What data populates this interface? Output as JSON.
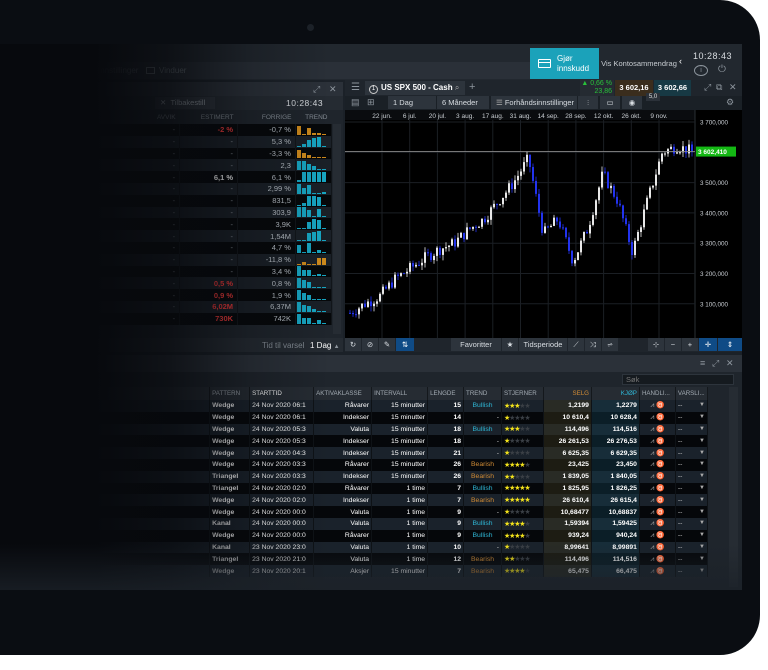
{
  "topbar": {
    "tabs": [
      "Innstillinger",
      "Vinduer"
    ],
    "deposit_label": "Gjør innskudd",
    "summary_label": "Vis Kontosammendrag",
    "clock": "10:28:43"
  },
  "left_panel": {
    "reset_label": "Tilbakestill",
    "clock": "10:28:43",
    "columns": [
      "AVVIK",
      "ESTIMERT",
      "FORRIGE",
      "TREND"
    ],
    "rows": [
      {
        "avvik": "-",
        "est": "-2 %",
        "est_style": "red",
        "prev": "-0,7 %",
        "trend": [
          8,
          0,
          6,
          2,
          2,
          1
        ],
        "tc": "#d08b1c"
      },
      {
        "avvik": "-",
        "est": "-",
        "prev": "5,3 %",
        "trend": [
          1,
          2,
          6,
          8,
          9,
          0
        ],
        "tc": "#17a7c4"
      },
      {
        "avvik": "-",
        "est": "-",
        "prev": "-3,3 %",
        "trend": [
          8,
          5,
          3,
          1,
          1,
          0
        ],
        "tc": "#d08b1c"
      },
      {
        "avvik": "-",
        "est": "-",
        "prev": "2,3",
        "trend": [
          8,
          8,
          6,
          4,
          1,
          0
        ],
        "tc": "#17a7c4"
      },
      {
        "avvik": "-",
        "est": "6,1 %",
        "est_style": "wh",
        "prev": "6,1 %",
        "trend": [
          2,
          9,
          9,
          9,
          9,
          9
        ],
        "tc": "#17a7c4"
      },
      {
        "avvik": "-",
        "est": "-",
        "prev": "2,99 %",
        "trend": [
          9,
          5,
          8,
          0,
          1,
          2
        ],
        "tc": "#17a7c4"
      },
      {
        "avvik": "-",
        "est": "-",
        "prev": "831,5",
        "trend": [
          1,
          2,
          9,
          9,
          8,
          0
        ],
        "tc": "#17a7c4"
      },
      {
        "avvik": "-",
        "est": "-",
        "prev": "303,9",
        "trend": [
          9,
          9,
          7,
          1,
          8,
          0
        ],
        "tc": "#17a7c4"
      },
      {
        "avvik": "-",
        "est": "-",
        "prev": "3,9K",
        "trend": [
          0,
          1,
          7,
          9,
          8,
          0
        ],
        "tc": "#17a7c4"
      },
      {
        "avvik": "-",
        "est": "-",
        "prev": "1,54M",
        "trend": [
          0,
          1,
          7,
          8,
          9,
          0
        ],
        "tc": "#17a7c4"
      },
      {
        "avvik": "-",
        "est": "-",
        "prev": "4,7 %",
        "trend": [
          7,
          0,
          9,
          0,
          3,
          0
        ],
        "tc": "#17a7c4"
      },
      {
        "avvik": "-",
        "est": "-",
        "prev": "-11,8 %",
        "trend": [
          1,
          2,
          1,
          0,
          6,
          6
        ],
        "tc": "#d08b1c"
      },
      {
        "avvik": "-",
        "est": "-",
        "prev": "3,4 %",
        "trend": [
          9,
          6,
          6,
          1,
          2,
          0
        ],
        "tc": "#17a7c4"
      },
      {
        "avvik": "-",
        "est": "0,5 %",
        "est_style": "red",
        "prev": "0,8 %",
        "trend": [
          9,
          7,
          6,
          1,
          1,
          0
        ],
        "tc": "#17a7c4"
      },
      {
        "avvik": "-",
        "est": "0,9 %",
        "est_style": "red",
        "prev": "1,9 %",
        "trend": [
          9,
          6,
          5,
          1,
          1,
          0
        ],
        "tc": "#17a7c4"
      },
      {
        "avvik": "-",
        "est": "6,02M",
        "est_style": "red",
        "prev": "6,37M",
        "trend": [
          9,
          6,
          5,
          3,
          1,
          0
        ],
        "tc": "#17a7c4"
      },
      {
        "avvik": "-",
        "est": "730K",
        "est_style": "red",
        "prev": "742K",
        "trend": [
          9,
          5,
          5,
          1,
          3,
          0
        ],
        "tc": "#17a7c4"
      }
    ],
    "footer_label": "Tid til varsel",
    "footer_value": "1 Dag"
  },
  "chart": {
    "instrument": "US SPX 500 - Cash",
    "change_pct": "0,66 %",
    "change_abs": "23,86",
    "sell": "3 602,16",
    "buy": "3 602,66",
    "spread": "5,0",
    "interval": "1 Dag",
    "period": "6 Måneder",
    "presets_label": "Forhåndsinnstillinger",
    "date_labels": [
      "22 jun.",
      "6 jul.",
      "20 jul.",
      "3 aug.",
      "17 aug.",
      "31 aug.",
      "14 sep.",
      "28 sep.",
      "12 okt.",
      "26 okt.",
      "9 nov."
    ],
    "price_labels": [
      "3 700,000",
      "3 600,000",
      "3 500,000",
      "3 400,000",
      "3 300,000",
      "3 200,000",
      "3 100,000"
    ],
    "current_price": "3 602,410",
    "current_value": 3602.41,
    "closes": [
      3070,
      3100,
      3125,
      3180,
      3215,
      3250,
      3280,
      3300,
      3345,
      3380,
      3440,
      3500,
      3580,
      3330,
      3380,
      3240,
      3350,
      3530,
      3440,
      3270,
      3440,
      3600,
      3620,
      3602.41
    ],
    "favorites_label": "Favoritter",
    "timeperiod_label": "Tidsperiode",
    "colors": {
      "up": "#e8e8e8",
      "down": "#2233ee",
      "price_tag": "#14b814"
    }
  },
  "scanner": {
    "search_placeholder": "Søk",
    "columns": [
      "PATTERN",
      "STARTTID",
      "AKTIVAKLASSE",
      "INTERVALL",
      "LENGDE",
      "TREND",
      "STJERNER",
      "SELG",
      "KJØP",
      "HANDLI...",
      "VARSLI..."
    ],
    "rows": [
      [
        "Wedge",
        "24 Nov 2020 06:1",
        "Råvarer",
        "15 minutter",
        "15",
        "Bullish",
        3,
        "1,2199",
        "1,2279"
      ],
      [
        "Wedge",
        "24 Nov 2020 06:1",
        "Indekser",
        "15 minutter",
        "14",
        "-",
        1,
        "10 610,4",
        "10 628,4"
      ],
      [
        "Wedge",
        "24 Nov 2020 05:3",
        "Valuta",
        "15 minutter",
        "18",
        "Bullish",
        3,
        "114,496",
        "114,516"
      ],
      [
        "Wedge",
        "24 Nov 2020 05:3",
        "Indekser",
        "15 minutter",
        "18",
        "-",
        1,
        "26 261,53",
        "26 276,53"
      ],
      [
        "Wedge",
        "24 Nov 2020 04:3",
        "Indekser",
        "15 minutter",
        "21",
        "-",
        1,
        "6 625,35",
        "6 629,35"
      ],
      [
        "Wedge",
        "24 Nov 2020 03:3",
        "Råvarer",
        "15 minutter",
        "26",
        "Bearish",
        4,
        "23,425",
        "23,450"
      ],
      [
        "Triangel",
        "24 Nov 2020 03:3",
        "Indekser",
        "15 minutter",
        "26",
        "Bearish",
        2,
        "1 839,05",
        "1 840,05"
      ],
      [
        "Triangel",
        "24 Nov 2020 02:0",
        "Råvarer",
        "1 time",
        "7",
        "Bullish",
        5,
        "1 825,95",
        "1 826,25"
      ],
      [
        "Wedge",
        "24 Nov 2020 02:0",
        "Indekser",
        "1 time",
        "7",
        "Bearish",
        5,
        "26 610,4",
        "26 615,4"
      ],
      [
        "Wedge",
        "24 Nov 2020 00:0",
        "Valuta",
        "1 time",
        "9",
        "-",
        1,
        "10,68477",
        "10,68837"
      ],
      [
        "Kanal",
        "24 Nov 2020 00:0",
        "Valuta",
        "1 time",
        "9",
        "Bullish",
        4,
        "1,59394",
        "1,59425"
      ],
      [
        "Wedge",
        "24 Nov 2020 00:0",
        "Råvarer",
        "1 time",
        "9",
        "Bullish",
        4,
        "939,24",
        "940,24"
      ],
      [
        "Kanal",
        "23 Nov 2020 23:0",
        "Valuta",
        "1 time",
        "10",
        "-",
        1,
        "8,99641",
        "8,99891"
      ],
      [
        "Triangel",
        "23 Nov 2020 21:0",
        "Valuta",
        "1 time",
        "12",
        "Bearish",
        2,
        "114,496",
        "114,516"
      ],
      [
        "Wedge",
        "23 Nov 2020 20:1",
        "Aksjer",
        "15 minutter",
        "7",
        "Bearish",
        4,
        "65,475",
        "66,475"
      ]
    ],
    "action_placeholder": "--"
  }
}
